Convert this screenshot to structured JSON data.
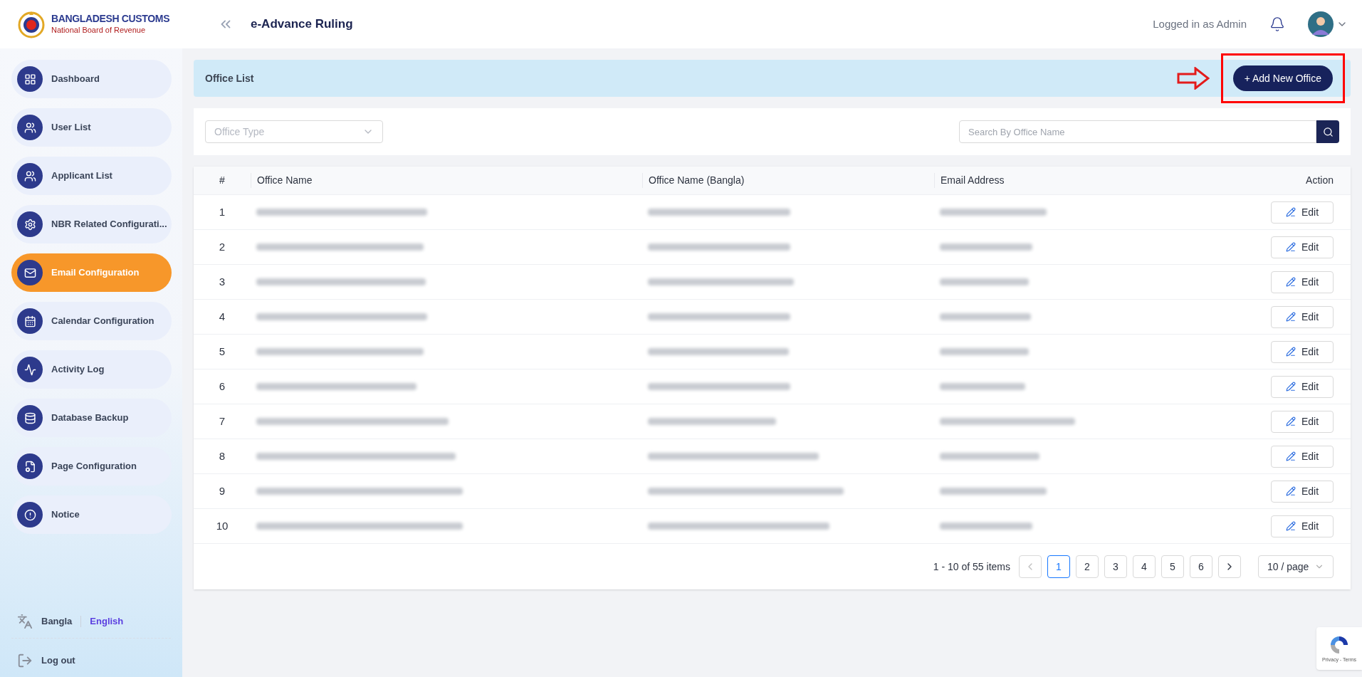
{
  "brand": {
    "title": "BANGLADESH CUSTOMS",
    "subtitle": "National Board of Revenue"
  },
  "header": {
    "app_title": "e-Advance Ruling",
    "user_label": "Logged in as Admin"
  },
  "sidebar": {
    "items": [
      {
        "label": "Dashboard",
        "selected": false
      },
      {
        "label": "User List",
        "selected": false
      },
      {
        "label": "Applicant List",
        "selected": false
      },
      {
        "label": "NBR Related Configurati...",
        "selected": false
      },
      {
        "label": "Email Configuration",
        "selected": true
      },
      {
        "label": "Calendar Configuration",
        "selected": false
      },
      {
        "label": "Activity Log",
        "selected": false
      },
      {
        "label": "Database Backup",
        "selected": false
      },
      {
        "label": "Page Configuration",
        "selected": false
      },
      {
        "label": "Notice",
        "selected": false
      }
    ],
    "languages": [
      {
        "label": "Bangla",
        "selected": false
      },
      {
        "label": "English",
        "selected": true
      }
    ],
    "logout": "Log out"
  },
  "page": {
    "title": "Office List",
    "add_button": "+ Add New Office"
  },
  "filters": {
    "office_type_placeholder": "Office Type",
    "search_placeholder": "Search By Office Name"
  },
  "table": {
    "columns": [
      "#",
      "Office Name",
      "Office Name (Bangla)",
      "Email Address",
      "Action"
    ],
    "rows": [
      {
        "number": "1",
        "action": "Edit"
      },
      {
        "number": "2",
        "action": "Edit"
      },
      {
        "number": "3",
        "action": "Edit"
      },
      {
        "number": "4",
        "action": "Edit"
      },
      {
        "number": "5",
        "action": "Edit"
      },
      {
        "number": "6",
        "action": "Edit"
      },
      {
        "number": "7",
        "action": "Edit"
      },
      {
        "number": "8",
        "action": "Edit"
      },
      {
        "number": "9",
        "action": "Edit"
      },
      {
        "number": "10",
        "action": "Edit"
      }
    ]
  },
  "pagination": {
    "summary": "1 - 10 of 55 items",
    "pages": [
      {
        "label": "1",
        "selected": true
      },
      {
        "label": "2",
        "selected": false
      },
      {
        "label": "3",
        "selected": false
      },
      {
        "label": "4",
        "selected": false
      },
      {
        "label": "5",
        "selected": false
      },
      {
        "label": "6",
        "selected": false
      }
    ],
    "page_size": "10 / page"
  },
  "recaptcha": {
    "text": "Privacy - Terms"
  }
}
